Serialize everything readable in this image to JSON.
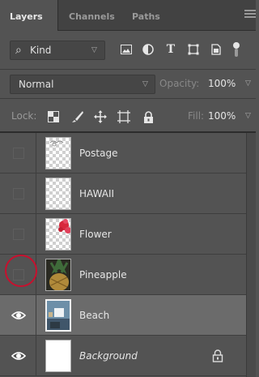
{
  "tabs": [
    {
      "label": "Layers",
      "active": true
    },
    {
      "label": "Channels",
      "active": false
    },
    {
      "label": "Paths",
      "active": false
    }
  ],
  "filter": {
    "kind_label": "Kind",
    "icons": [
      "image-filter-icon",
      "adjustment-filter-icon",
      "type-filter-icon",
      "shape-filter-icon",
      "smart-object-filter-icon"
    ]
  },
  "blend": {
    "mode": "Normal",
    "opacity_label": "Opacity:",
    "opacity_value": "100%"
  },
  "lock": {
    "label": "Lock:",
    "icons": [
      "lock-transparent-pixels-icon",
      "lock-image-pixels-icon",
      "lock-position-icon",
      "lock-artboard-icon",
      "lock-all-icon"
    ],
    "fill_label": "Fill:",
    "fill_value": "100%"
  },
  "layers": [
    {
      "name": "Postage",
      "visible": false,
      "thumb": "postage"
    },
    {
      "name": "HAWAII",
      "visible": false,
      "thumb": "hawaii"
    },
    {
      "name": "Flower",
      "visible": false,
      "thumb": "flower"
    },
    {
      "name": "Pineapple",
      "visible": false,
      "thumb": "pineapple",
      "highlighted": true
    },
    {
      "name": "Beach",
      "visible": true,
      "thumb": "beach",
      "selected": true
    },
    {
      "name": "Background",
      "visible": true,
      "thumb": "white",
      "italic": true,
      "locked": true
    }
  ],
  "colors": {
    "panel": "#535353",
    "selected_row": "#6b6b6b",
    "highlight": "#c8102e"
  }
}
